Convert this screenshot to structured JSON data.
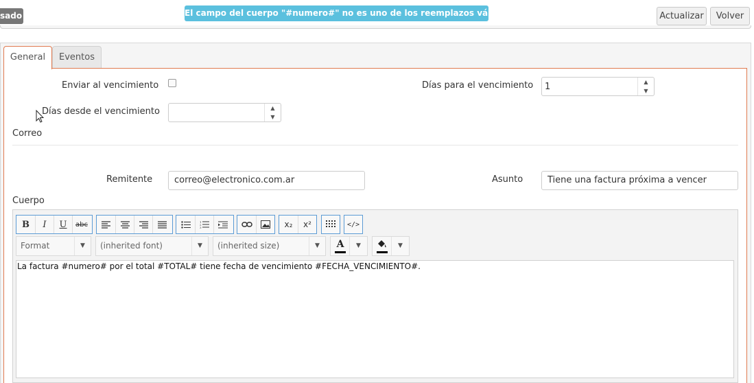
{
  "header": {
    "status_fragment": "sado",
    "alert_text": "El campo del cuerpo \"#numero#\" no es uno de los reemplazos válidos.",
    "update_label": "Actualizar",
    "back_label": "Volver"
  },
  "tabs": [
    {
      "label": "General",
      "active": true
    },
    {
      "label": "Eventos",
      "active": false
    }
  ],
  "form": {
    "send_on_due_label": "Enviar al vencimiento",
    "send_on_due_checked": false,
    "days_to_due_label": "Días para el vencimiento",
    "days_to_due_value": "1",
    "days_since_due_label": "Días desde el vencimiento",
    "days_since_due_value": "",
    "email_section_label": "Correo",
    "sender_label": "Remitente",
    "sender_value": "correo@electronico.com.ar",
    "subject_label": "Asunto",
    "subject_value": "Tiene una factura próxima a vencer",
    "body_label": "Cuerpo"
  },
  "editor": {
    "bold_label": "B",
    "italic_label": "I",
    "underline_label": "U",
    "strike_label": "abc",
    "format_label": "Format",
    "font_label": "(inherited font)",
    "size_label": "(inherited size)",
    "text_color_label": "A",
    "subscript_label": "x₂",
    "superscript_label": "x²",
    "body_text": "La factura #numero# por el total #TOTAL# tiene fecha de vencimiento #FECHA_VENCIMIENTO#."
  },
  "colors": {
    "alert_bg": "#5bc0de",
    "active_tab_border": "#e07a4f",
    "toolbar_group_border": "#5b9bd5"
  }
}
